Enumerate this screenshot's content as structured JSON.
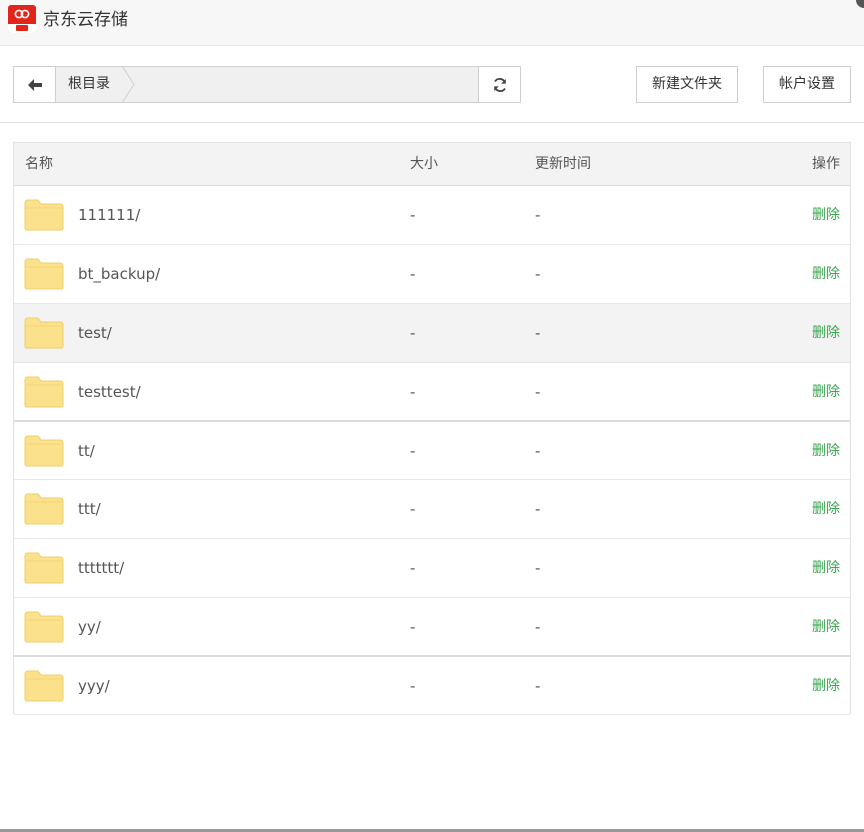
{
  "app": {
    "title": "京东云存储",
    "accent": "#e1251b"
  },
  "toolbar": {
    "back_icon": "arrow-left-icon",
    "breadcrumb_root": "根目录",
    "refresh_icon": "refresh-icon",
    "new_folder_label": "新建文件夹",
    "account_settings_label": "帐户设置"
  },
  "table": {
    "headers": {
      "name": "名称",
      "size": "大小",
      "mtime": "更新时间",
      "action": "操作"
    },
    "rows": [
      {
        "name": "111111/",
        "size": "-",
        "mtime": "-",
        "action": "删除"
      },
      {
        "name": "bt_backup/",
        "size": "-",
        "mtime": "-",
        "action": "删除"
      },
      {
        "name": "test/",
        "size": "-",
        "mtime": "-",
        "action": "删除"
      },
      {
        "name": "testtest/",
        "size": "-",
        "mtime": "-",
        "action": "删除"
      },
      {
        "name": "tt/",
        "size": "-",
        "mtime": "-",
        "action": "删除"
      },
      {
        "name": "ttt/",
        "size": "-",
        "mtime": "-",
        "action": "删除"
      },
      {
        "name": "ttttttt/",
        "size": "-",
        "mtime": "-",
        "action": "删除"
      },
      {
        "name": "yy/",
        "size": "-",
        "mtime": "-",
        "action": "删除"
      },
      {
        "name": "yyy/",
        "size": "-",
        "mtime": "-",
        "action": "删除"
      }
    ],
    "row_icon": "folder-icon",
    "action_color": "#3aa650"
  }
}
